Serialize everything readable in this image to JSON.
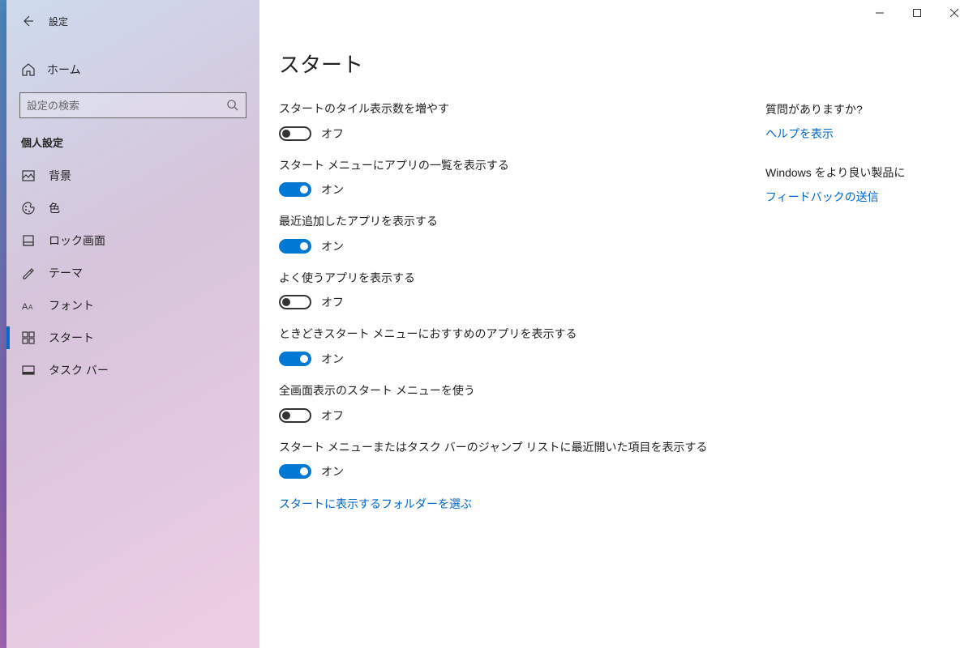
{
  "window": {
    "title": "設定"
  },
  "sidebar": {
    "home": "ホーム",
    "searchPlaceholder": "設定の検索",
    "section": "個人設定",
    "items": [
      {
        "label": "背景"
      },
      {
        "label": "色"
      },
      {
        "label": "ロック画面"
      },
      {
        "label": "テーマ"
      },
      {
        "label": "フォント"
      },
      {
        "label": "スタート"
      },
      {
        "label": "タスク バー"
      }
    ]
  },
  "page": {
    "title": "スタート",
    "settings": [
      {
        "label": "スタートのタイル表示数を増やす",
        "state": "off",
        "stateText": "オフ"
      },
      {
        "label": "スタート メニューにアプリの一覧を表示する",
        "state": "on",
        "stateText": "オン"
      },
      {
        "label": "最近追加したアプリを表示する",
        "state": "on",
        "stateText": "オン"
      },
      {
        "label": "よく使うアプリを表示する",
        "state": "off",
        "stateText": "オフ"
      },
      {
        "label": "ときどきスタート メニューにおすすめのアプリを表示する",
        "state": "on",
        "stateText": "オン"
      },
      {
        "label": "全画面表示のスタート メニューを使う",
        "state": "off",
        "stateText": "オフ"
      },
      {
        "label": "スタート メニューまたはタスク バーのジャンプ リストに最近開いた項目を表示する",
        "state": "on",
        "stateText": "オン"
      }
    ],
    "footerLink": "スタートに表示するフォルダーを選ぶ"
  },
  "aside": {
    "help": {
      "heading": "質問がありますか?",
      "link": "ヘルプを表示"
    },
    "feedback": {
      "heading": "Windows をより良い製品に",
      "link": "フィードバックの送信"
    }
  }
}
